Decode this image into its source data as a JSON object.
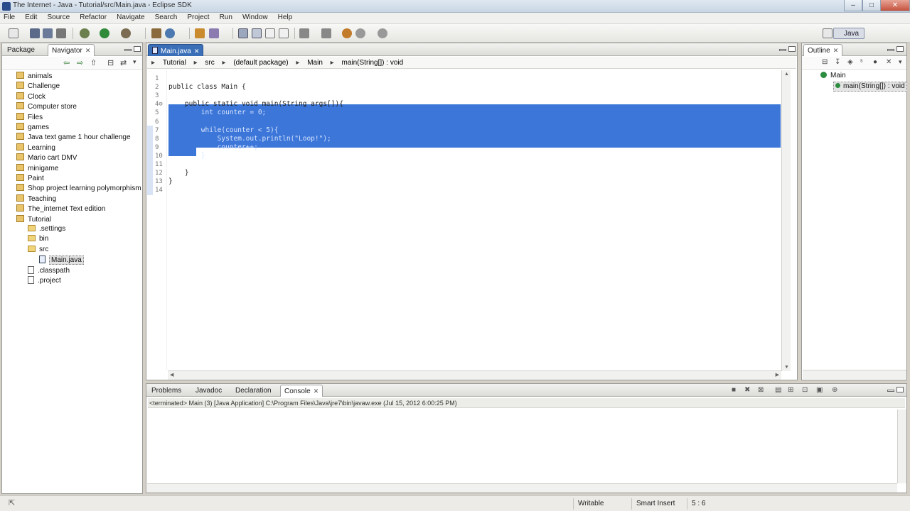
{
  "window": {
    "title": "The Internet - Java - Tutorial/src/Main.java - Eclipse SDK",
    "controls": [
      "–",
      "□",
      "✕"
    ]
  },
  "menu": [
    "File",
    "Edit",
    "Source",
    "Refactor",
    "Navigate",
    "Search",
    "Project",
    "Run",
    "Window",
    "Help"
  ],
  "toolbar": {
    "perspective_label": "Java"
  },
  "left_panel": {
    "tabs": [
      {
        "label": "Package",
        "active": false
      },
      {
        "label": "Navigator",
        "active": true
      }
    ],
    "tree": [
      {
        "label": "animals",
        "type": "project",
        "depth": 0
      },
      {
        "label": "Challenge",
        "type": "project",
        "depth": 0
      },
      {
        "label": "Clock",
        "type": "project",
        "depth": 0
      },
      {
        "label": "Computer store",
        "type": "project",
        "depth": 0
      },
      {
        "label": "Files",
        "type": "project",
        "depth": 0
      },
      {
        "label": "games",
        "type": "project",
        "depth": 0
      },
      {
        "label": "Java text game 1 hour challenge",
        "type": "project",
        "depth": 0
      },
      {
        "label": "Learning",
        "type": "project",
        "depth": 0
      },
      {
        "label": "Mario cart DMV",
        "type": "project",
        "depth": 0
      },
      {
        "label": "minigame",
        "type": "project",
        "depth": 0
      },
      {
        "label": "Paint",
        "type": "project",
        "depth": 0
      },
      {
        "label": "Shop project learning polymorphism",
        "type": "project",
        "depth": 0
      },
      {
        "label": "Teaching",
        "type": "project",
        "depth": 0
      },
      {
        "label": "The_internet Text edition",
        "type": "project",
        "depth": 0
      },
      {
        "label": "Tutorial",
        "type": "project",
        "depth": 0
      },
      {
        "label": ".settings",
        "type": "folder",
        "depth": 1
      },
      {
        "label": "bin",
        "type": "folder",
        "depth": 1
      },
      {
        "label": "src",
        "type": "folder",
        "depth": 1
      },
      {
        "label": "Main.java",
        "type": "java",
        "depth": 2,
        "selected": true
      },
      {
        "label": ".classpath",
        "type": "file",
        "depth": 1
      },
      {
        "label": ".project",
        "type": "file",
        "depth": 1
      }
    ]
  },
  "editor": {
    "tab_label": "Main.java",
    "breadcrumb": [
      "Tutorial",
      "src",
      "(default package)",
      "Main",
      "main(String[]) : void"
    ],
    "lines": [
      {
        "n": "1",
        "text": ""
      },
      {
        "n": "2",
        "text": "public class Main {"
      },
      {
        "n": "3",
        "text": ""
      },
      {
        "n": "4⊖",
        "text": "    public static void main(String args[]){"
      },
      {
        "n": "5",
        "text": "        int counter = 0;"
      },
      {
        "n": "6",
        "text": ""
      },
      {
        "n": "7",
        "text": "        while(counter < 5){"
      },
      {
        "n": "8",
        "text": "            System.out.println(\"Loop!\");"
      },
      {
        "n": "9",
        "text": "            counter++;"
      },
      {
        "n": "10",
        "text": "        }"
      },
      {
        "n": "11",
        "text": ""
      },
      {
        "n": "12",
        "text": "    }"
      },
      {
        "n": "13",
        "text": "}"
      },
      {
        "n": "14",
        "text": ""
      }
    ]
  },
  "outline": {
    "tab_label": "Outline",
    "items": [
      {
        "label": "Main",
        "depth": 0
      },
      {
        "label": "main(String[]) : void",
        "depth": 1
      }
    ]
  },
  "bottom_panel": {
    "tabs": [
      {
        "label": "Problems",
        "active": false
      },
      {
        "label": "Javadoc",
        "active": false
      },
      {
        "label": "Declaration",
        "active": false
      },
      {
        "label": "Console",
        "active": true
      }
    ],
    "console_header": "<terminated> Main (3) [Java Application] C:\\Program Files\\Java\\jre7\\bin\\javaw.exe (Jul 15, 2012 6:00:25 PM)"
  },
  "status": {
    "writable": "Writable",
    "insert_mode": "Smart Insert",
    "position": "5 : 6"
  },
  "colors": {
    "selection": "#3b76d8",
    "keyword": "#7f0055",
    "string": "#2a00ff"
  }
}
